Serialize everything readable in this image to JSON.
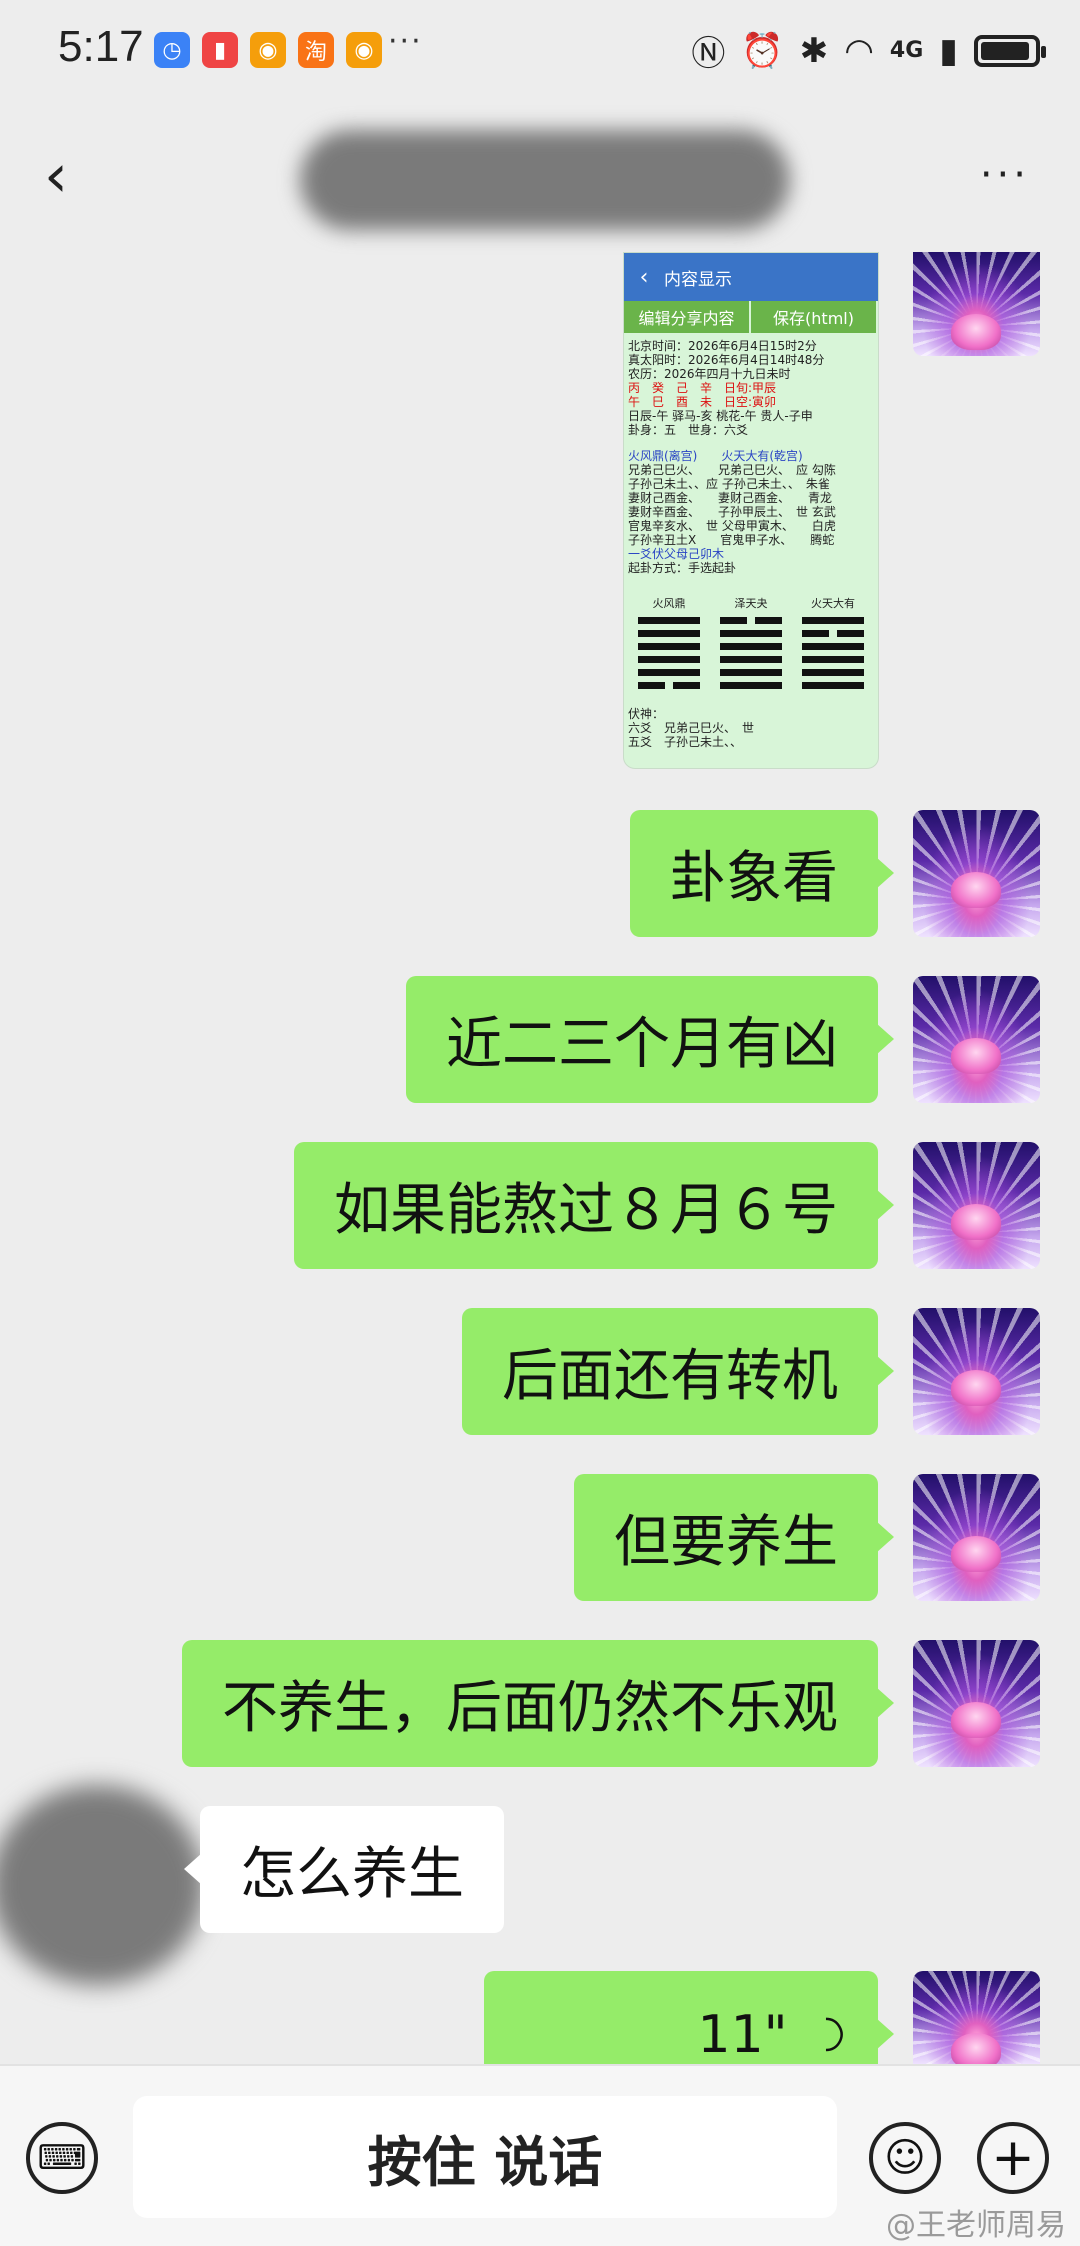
{
  "status_bar": {
    "time": "5:17",
    "notifications": [
      {
        "icon": "calendar-app-icon",
        "color": "#3b82f6",
        "glyph": "◷"
      },
      {
        "icon": "notes-app-icon",
        "color": "#ef4444",
        "glyph": "▮"
      },
      {
        "icon": "weibo-icon",
        "color": "#f59e0b",
        "glyph": "◉"
      },
      {
        "icon": "taobao-icon",
        "color": "#f97316",
        "glyph": "淘"
      },
      {
        "icon": "weibo-icon",
        "color": "#f59e0b",
        "glyph": "◉"
      }
    ],
    "more_indicator": "···",
    "network_label": "4G"
  },
  "nav": {
    "back_glyph": "‹",
    "menu_glyph": "···"
  },
  "shared_screenshot": {
    "header_title": "内容显示",
    "buttons": [
      "编辑分享内容",
      "保存(html)"
    ],
    "lines": [
      "北京时间：2026年6月4日15时2分",
      "真太阳时：2026年6月4日14时48分",
      "农历：2026年四月十九日未时",
      "日辰-午 驿马-亥 桃花-午 贵人-子申",
      "卦身：五　世身：六爻"
    ],
    "ganzhi_top": "丙　癸　己　辛　日旬:甲辰",
    "ganzhi_bottom": "午　巳　酉　未　日空:寅卯",
    "gua_names": "火风鼎(离宫)　　火天大有(乾宫)",
    "gua_lines": [
      "兄弟己巳火、　　兄弟己巳火、　应 勾陈",
      "子孙己未土、、应 子孙己未土、、　朱雀",
      "妻财己酉金、　　妻财己酉金、　　青龙",
      "妻财辛酉金、　　子孙甲辰土、　世 玄武",
      "官鬼辛亥水、　世 父母甲寅木、　　白虎",
      "子孙辛丑土X　　官鬼甲子水、　　腾蛇"
    ],
    "fu_line": "一爻伏父母己卯木",
    "method_line": "起卦方式：手选起卦",
    "hexagram_labels": [
      "火风鼎",
      "泽天夬",
      "火天大有"
    ],
    "hexagrams": [
      [
        1,
        1,
        1,
        1,
        1,
        0
      ],
      [
        0,
        1,
        1,
        1,
        1,
        1
      ],
      [
        1,
        0,
        1,
        1,
        1,
        1
      ]
    ],
    "fushen_lines": [
      "伏神：",
      "六爻　兄弟己巳火、　世",
      "五爻　子孙己未土、、"
    ]
  },
  "messages": [
    {
      "text": "卦象看"
    },
    {
      "text": "近二三个月有凶"
    },
    {
      "text": "如果能熬过８月６号"
    },
    {
      "text": "后面还有转机"
    },
    {
      "text": "但要养生"
    },
    {
      "text": "不养生，后面仍然不乐观"
    }
  ],
  "incoming_message": {
    "text": "怎么养生"
  },
  "voice_message": {
    "duration": "11\"",
    "icon": "voice-wave-icon"
  },
  "bottom_bar": {
    "talk_label": "按住 说话",
    "keyboard_icon": "keyboard-icon",
    "emoji_icon": "emoji-icon",
    "plus_icon": "plus-icon"
  },
  "watermark": "@王老师周易",
  "colors": {
    "outgoing_bubble": "#95ec69",
    "incoming_bubble": "#ffffff",
    "background": "#ededed"
  }
}
